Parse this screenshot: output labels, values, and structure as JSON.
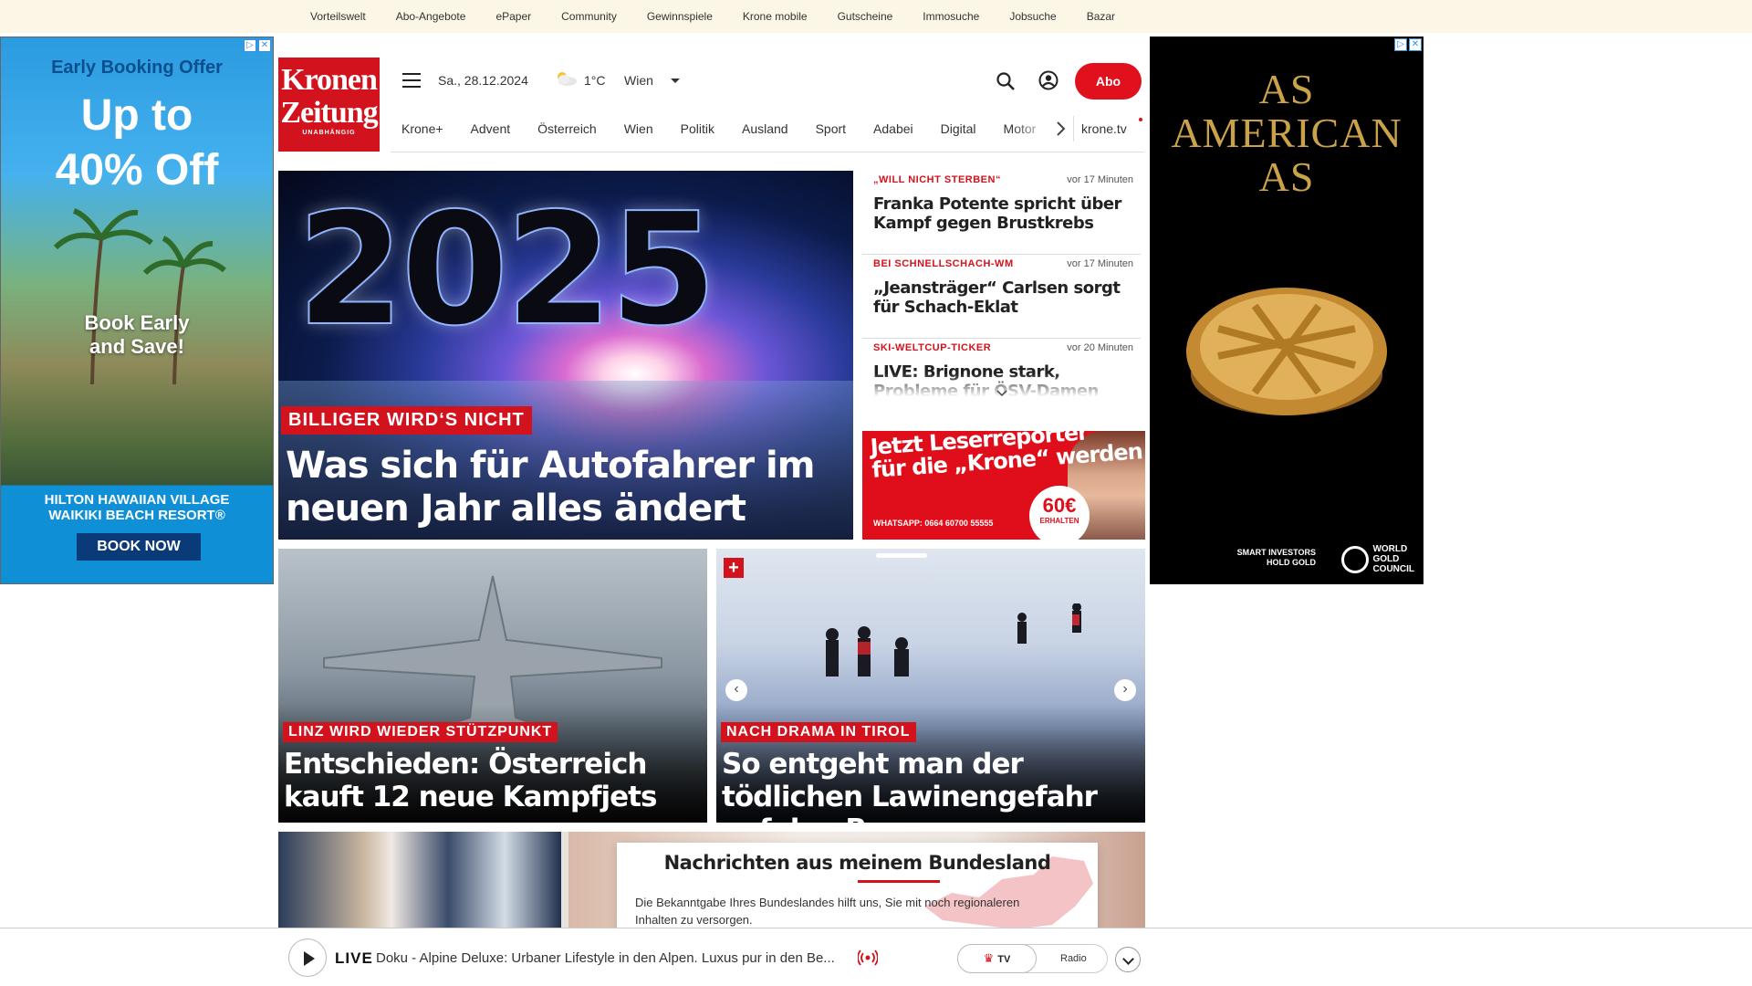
{
  "topbar": {
    "links": [
      "Vorteilswelt",
      "Abo-Angebote",
      "ePaper",
      "Community",
      "Gewinnspiele",
      "Krone mobile",
      "Gutscheine",
      "Immosuche",
      "Jobsuche",
      "Bazar"
    ]
  },
  "ad_left": {
    "headline": "Early Booking Offer",
    "offer_line1": "Up to",
    "offer_line2": "40% Off",
    "tagline_line1": "Book Early",
    "tagline_line2": "and Save!",
    "brand_line1": "HILTON HAWAIIAN VILLAGE",
    "brand_line2": "WAIKIKI BEACH RESORT®",
    "cta": "BOOK NOW"
  },
  "ad_right": {
    "line1": "AS",
    "line2": "AMERICAN",
    "line3": "AS",
    "footer_left_line1": "SMART INVESTORS",
    "footer_left_line2": "HOLD GOLD",
    "footer_right_line1": "WORLD",
    "footer_right_line2": "GOLD",
    "footer_right_line3": "COUNCIL"
  },
  "logo": {
    "line1": "Kronen",
    "line2": "Zeitung",
    "line3": "UNABHÄNGIG"
  },
  "header": {
    "date": "Sa., 28.12.2024",
    "temperature": "1°C",
    "city": "Wien",
    "abo_label": "Abo"
  },
  "nav": {
    "items": [
      "Krone+",
      "Advent",
      "Österreich",
      "Wien",
      "Politik",
      "Ausland",
      "Sport",
      "Adabei",
      "Digital",
      "Motor"
    ],
    "tv": "krone.tv"
  },
  "hero": {
    "image_text": "2025",
    "kicker": "BILLIGER WIRD‘S NICHT",
    "title": "Was sich für Autofahrer im neuen Jahr alles ändert"
  },
  "news": [
    {
      "kicker": "„WILL NICHT STERBEN“",
      "time": "vor 17 Minuten",
      "title": "Franka Potente spricht über Kampf gegen Brustkrebs"
    },
    {
      "kicker": "BEI SCHNELLSCHACH-WM",
      "time": "vor 17 Minuten",
      "title": "„Jeansträger“ Carlsen sorgt für Schach-Eklat"
    },
    {
      "kicker": "SKI-WELTCUP-TICKER",
      "time": "vor 20 Minuten",
      "title": "LIVE: Brignone stark, Probleme für ÖSV-Damen"
    }
  ],
  "reporter": {
    "line1": "Jetzt Leserreporter",
    "line2": "für die „Krone“ werden",
    "whatsapp": "WHATSAPP: 0664 60700 55555",
    "amount": "60€",
    "amount_label": "ERHALTEN"
  },
  "cards": [
    {
      "kicker": "LINZ WIRD WIEDER STÜTZPUNKT",
      "title": "Entschieden: Österreich kauft 12 neue Kampfjets"
    },
    {
      "kicker": "NACH DRAMA IN TIROL",
      "title": "So entgeht man der tödlichen Lawinengefahr auf den Bergen"
    }
  ],
  "region": {
    "title": "Nachrichten aus meinem Bundesland",
    "text": "Die Bekanntgabe Ihres Bundeslandes hilft uns, Sie mit noch regionaleren Inhalten zu versorgen."
  },
  "livebar": {
    "live_label": "LIVE",
    "description": "Doku - Alpine Deluxe: Urbaner Lifestyle in den Alpen. Luxus pur in den Be...",
    "tv_label": "TV",
    "radio_label": "Radio"
  }
}
